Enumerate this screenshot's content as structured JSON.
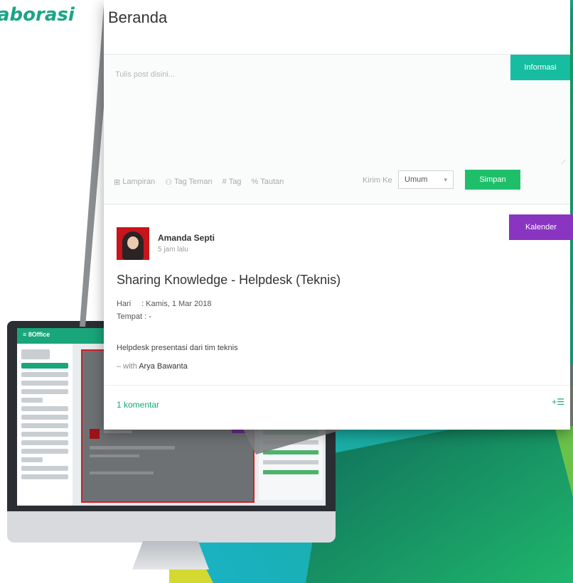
{
  "banner": {
    "text": "aborasi"
  },
  "colors": {
    "brand_green": "#19a67a",
    "teal": "#17bda1",
    "purple": "#8a35c1",
    "save_green": "#1fbf6a"
  },
  "beranda": {
    "title": "Beranda",
    "post": {
      "placeholder": "Tulis post disini...",
      "informasi_button": "Informasi",
      "toolbar": [
        {
          "icon": "attachment-icon",
          "label": "Lampiran"
        },
        {
          "icon": "users-tag-icon",
          "label": "Tag Teman"
        },
        {
          "icon": "hashtag-icon",
          "label": "Tag"
        },
        {
          "icon": "link-icon",
          "label": "Tautan"
        }
      ],
      "kirim_label": "Kirim Ke",
      "audience": "Umum",
      "save_button": "Simpan"
    },
    "feed": {
      "kalender_button": "Kalender",
      "author": "Amanda Septi",
      "time": "5 jam lalu",
      "title": "Sharing Knowledge - Helpdesk (Teknis)",
      "hari_label": "Hari",
      "hari_value": ": Kamis, 1 Mar 2018",
      "tempat_label": "Tempat",
      "tempat_value": ": -",
      "description": "Helpdesk presentasi dari tim teknis",
      "with_prefix": "– with",
      "with_name": "Arya Bawanta",
      "comments": "1 komentar"
    }
  }
}
